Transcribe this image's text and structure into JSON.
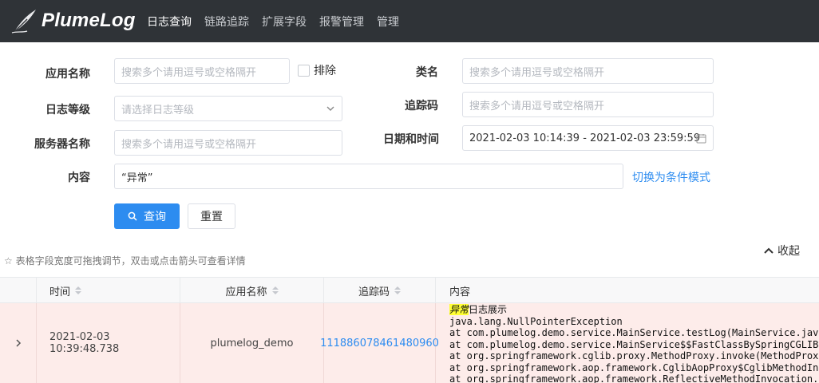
{
  "header": {
    "logo_text": "PlumeLog",
    "nav": [
      "日志查询",
      "链路追踪",
      "扩展字段",
      "报警管理",
      "管理"
    ]
  },
  "form": {
    "app_name_label": "应用名称",
    "app_name_placeholder": "搜索多个请用逗号或空格隔开",
    "exclude_label": "排除",
    "class_label": "类名",
    "class_placeholder": "搜索多个请用逗号或空格隔开",
    "level_label": "日志等级",
    "level_placeholder": "请选择日志等级",
    "trace_label": "追踪码",
    "trace_placeholder": "搜索多个请用逗号或空格隔开",
    "server_label": "服务器名称",
    "server_placeholder": "搜索多个请用逗号或空格隔开",
    "datetime_label": "日期和时间",
    "datetime_value": "2021-02-03 10:14:39 - 2021-02-03 23:59:59",
    "content_label": "内容",
    "content_value": "“异常”",
    "switch_mode_link": "切换为条件模式",
    "search_button": "查询",
    "reset_button": "重置"
  },
  "hint": "☆ 表格字段宽度可拖拽调节，双击或点击箭头可查看详情",
  "collapse_label": "收起",
  "table": {
    "columns": [
      "时间",
      "应用名称",
      "追踪码",
      "内容"
    ],
    "rows": [
      {
        "time": "2021-02-03 10:39:48.738",
        "app": "plumelog_demo",
        "trace": "111886078461480960",
        "highlight": "异常",
        "first_line_rest": "日志展示",
        "lines": [
          "java.lang.NullPointerException",
          "at com.plumelog.demo.service.MainService.testLog(MainService.java",
          "at com.plumelog.demo.service.MainService$$FastClassBySpringCGLIB",
          "at org.springframework.cglib.proxy.MethodProxy.invoke(MethodProxy",
          "at org.springframework.aop.framework.CglibAopProxy$CglibMethodInv",
          "at org.springframework.aop.framework.ReflectiveMethodInvocation."
        ]
      }
    ]
  },
  "colors": {
    "header_bg": "#2f3337",
    "primary": "#2d8cf0",
    "row_error_bg": "#fdecea",
    "highlight": "#ffff33"
  }
}
